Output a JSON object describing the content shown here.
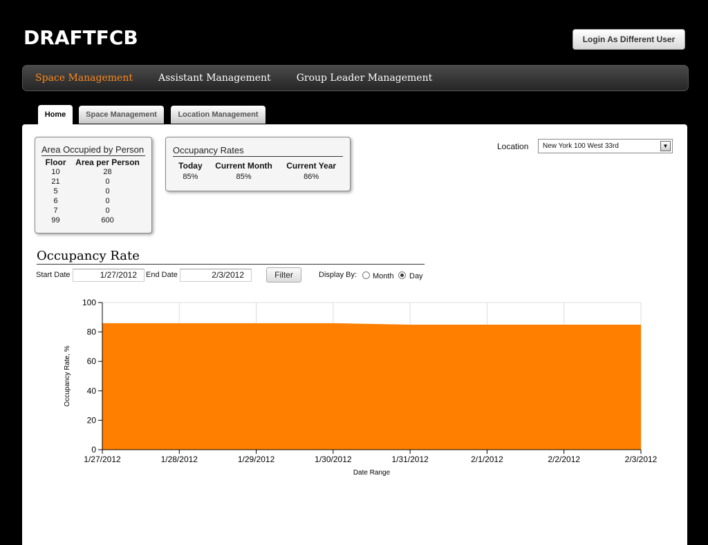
{
  "app": {
    "logo": "DRAFTFCB",
    "login_button": "Login As Different User"
  },
  "main_nav": [
    {
      "label": "Space Management",
      "active": true
    },
    {
      "label": "Assistant Management",
      "active": false
    },
    {
      "label": "Group Leader Management",
      "active": false
    }
  ],
  "sub_tabs": [
    {
      "label": "Home",
      "active": true
    },
    {
      "label": "Space Management",
      "active": false
    },
    {
      "label": "Location Management",
      "active": false
    }
  ],
  "area_card": {
    "title": "Area Occupied by Person",
    "headers": [
      "Floor",
      "Area per Person"
    ],
    "rows": [
      [
        "10",
        "28"
      ],
      [
        "21",
        "0"
      ],
      [
        "5",
        "0"
      ],
      [
        "6",
        "0"
      ],
      [
        "7",
        "0"
      ],
      [
        "99",
        "600"
      ]
    ]
  },
  "occupancy_card": {
    "title": "Occupancy Rates",
    "headers": [
      "Today",
      "Current Month",
      "Current Year"
    ],
    "values": [
      "85%",
      "85%",
      "86%"
    ]
  },
  "location": {
    "label": "Location",
    "selected": "New York 100 West 33rd"
  },
  "filters": {
    "section_title": "Occupancy Rate",
    "start_label": "Start Date",
    "start_value": "1/27/2012",
    "end_label": "End Date",
    "end_value": "2/3/2012",
    "filter_button": "Filter",
    "display_by_label": "Display By:",
    "options": [
      {
        "label": "Month",
        "selected": false
      },
      {
        "label": "Day",
        "selected": true
      }
    ]
  },
  "colors": {
    "accent": "#ff8a1a",
    "area_fill": "#ff8000"
  },
  "chart_data": {
    "type": "area",
    "x": [
      "1/27/2012",
      "1/28/2012",
      "1/29/2012",
      "1/30/2012",
      "1/31/2012",
      "2/1/2012",
      "2/2/2012",
      "2/3/2012"
    ],
    "series": [
      {
        "values": [
          86,
          86,
          86,
          86,
          85,
          85,
          85,
          85
        ]
      }
    ],
    "xlabel": "Date Range",
    "ylabel": "Occupancy Rate, %",
    "ylim": [
      0,
      100
    ],
    "yticks": [
      0,
      20,
      40,
      60,
      80,
      100
    ],
    "grid": true
  }
}
